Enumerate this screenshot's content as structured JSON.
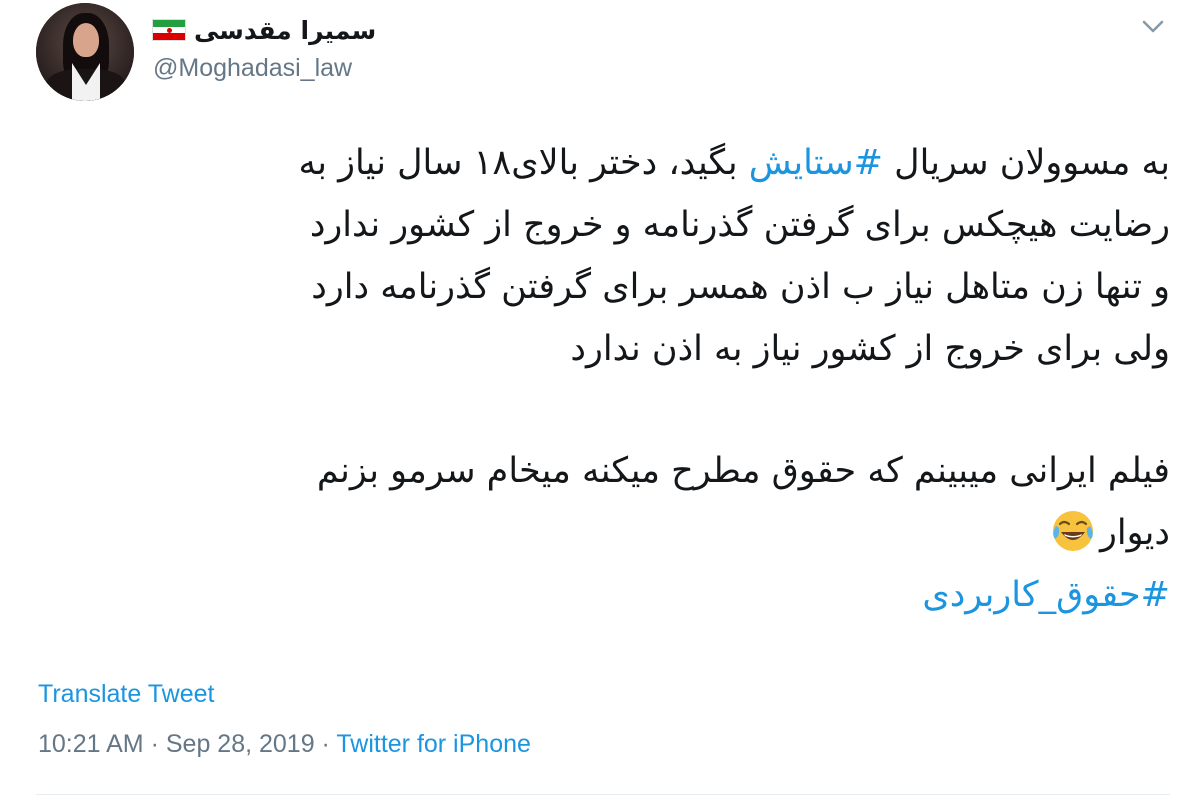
{
  "user": {
    "display_name": "سمیرا مقدسی",
    "handle": "@Moghadasi_law",
    "flag_icon": "iran-flag-icon"
  },
  "tweet": {
    "line1_a": "به مسوولان سریال ",
    "line1_hashtag": "#ستایش",
    "line1_b": " بگید، دختر بالای۱۸ سال نیاز به",
    "line2": "رضایت هیچکس برای گرفتن گذرنامه و خروج از کشور ندارد",
    "line3": "و تنها زن متاهل نیاز ب اذن همسر برای گرفتن گذرنامه دارد",
    "line4": "ولی برای خروج از کشور نیاز به اذن ندارد",
    "line5": "فیلم ایرانی میبینم که حقوق مطرح میکنه میخام سرمو بزنم",
    "line6": "دیوار",
    "emoji": "face-with-tears-of-joy",
    "hashtag2": "#حقوق_کاربردی"
  },
  "translate_label": "Translate Tweet",
  "meta": {
    "time": "10:21 AM",
    "separator1": " · ",
    "date": "Sep 28, 2019",
    "separator2": " · ",
    "source": "Twitter for iPhone"
  },
  "colors": {
    "link": "#1b95e0",
    "secondary": "#657786",
    "text": "#14171a"
  }
}
